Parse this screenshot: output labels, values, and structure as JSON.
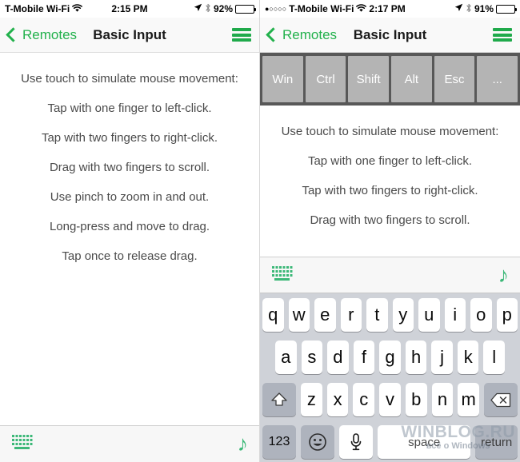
{
  "colors": {
    "accent_green": "#22b14c",
    "icon_green": "#3cb878",
    "navbar_bg": "#f9f9f9",
    "modbar_bg": "#585858",
    "modkey_bg": "#b4b4b4",
    "keyboard_bg": "#cfd2d8",
    "key_white": "#ffffff",
    "key_dark": "#aeb3bd"
  },
  "left_phone": {
    "status_bar": {
      "carrier": "T-Mobile Wi-Fi",
      "wifi_icon": "wifi-icon",
      "time": "2:15 PM",
      "location_icon": "location-arrow-icon",
      "bluetooth_icon": "bluetooth-icon",
      "battery_percent": "92%",
      "battery_icon": "battery-full-icon"
    },
    "nav_bar": {
      "back_label": "Remotes",
      "back_icon": "chevron-left-icon",
      "title": "Basic Input",
      "menu_icon": "hamburger-menu-icon"
    },
    "instructions": [
      "Use touch to simulate mouse movement:",
      "Tap with one finger to left-click.",
      "Tap with two fingers to right-click.",
      "Drag with two fingers to scroll.",
      "Use pinch to zoom in and out.",
      "Long-press and move to drag.",
      "Tap once to release drag."
    ],
    "accessory_bar": {
      "keyboard_icon": "keyboard-icon",
      "note_icon": "music-note-icon",
      "note_glyph": "♪"
    }
  },
  "right_phone": {
    "status_bar": {
      "signal_dots": "●○○○○",
      "carrier": "T-Mobile Wi-Fi",
      "wifi_icon": "wifi-icon",
      "time": "2:17 PM",
      "location_icon": "location-arrow-icon",
      "bluetooth_icon": "bluetooth-icon",
      "battery_percent": "91%",
      "battery_icon": "battery-full-icon"
    },
    "nav_bar": {
      "back_label": "Remotes",
      "back_icon": "chevron-left-icon",
      "title": "Basic Input",
      "menu_icon": "hamburger-menu-icon"
    },
    "modifier_keys": [
      "Win",
      "Ctrl",
      "Shift",
      "Alt",
      "Esc",
      "..."
    ],
    "instructions": [
      "Use touch to simulate mouse movement:",
      "Tap with one finger to left-click.",
      "Tap with two fingers to right-click.",
      "Drag with two fingers to scroll."
    ],
    "accessory_bar": {
      "keyboard_icon": "keyboard-icon",
      "note_icon": "music-note-icon",
      "note_glyph": "♪"
    },
    "keyboard": {
      "row1": [
        "q",
        "w",
        "e",
        "r",
        "t",
        "y",
        "u",
        "i",
        "o",
        "p"
      ],
      "row2": [
        "a",
        "s",
        "d",
        "f",
        "g",
        "h",
        "j",
        "k",
        "l"
      ],
      "row3_letters": [
        "z",
        "x",
        "c",
        "v",
        "b",
        "n",
        "m"
      ],
      "shift_icon": "shift-arrow-icon",
      "shift_glyph": "⇧",
      "backspace_icon": "backspace-icon",
      "backspace_glyph": "⌫",
      "numbers_label": "123",
      "emoji_icon": "emoji-smiley-icon",
      "emoji_glyph": "☺",
      "microphone_icon": "microphone-icon",
      "microphone_glyph": "⬤",
      "space_label": "space",
      "return_label": "return"
    }
  },
  "watermark": {
    "main": "WINBLOG.RU",
    "sub": "всё о Windows"
  }
}
